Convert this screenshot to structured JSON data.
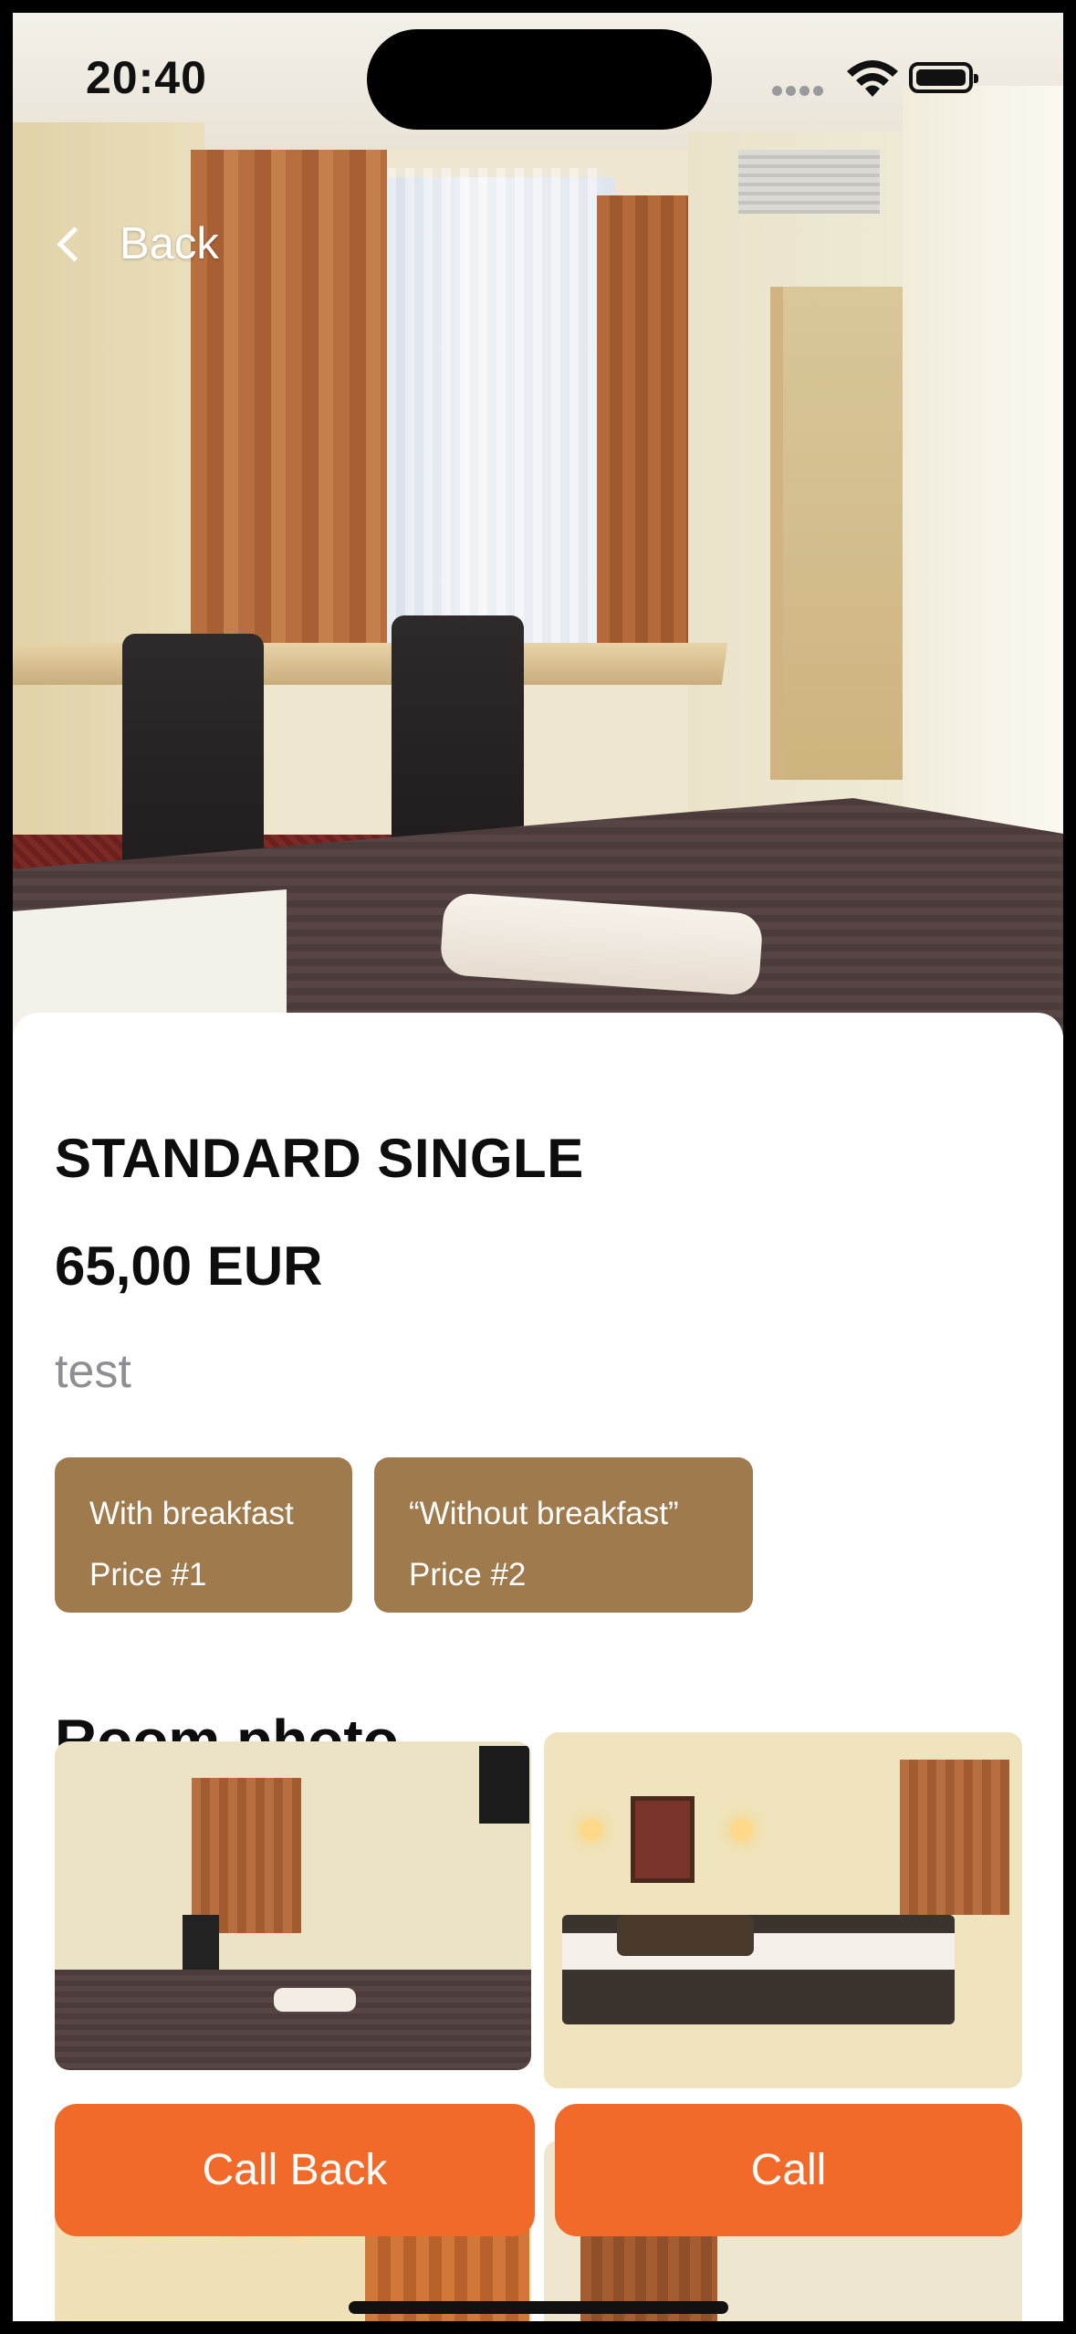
{
  "status_bar": {
    "time": "20:40"
  },
  "nav": {
    "back_label": "Back"
  },
  "room": {
    "title": "STANDARD SINGLE",
    "price": "65,00 EUR",
    "description": "test"
  },
  "options": [
    {
      "name": "With breakfast",
      "price_label": "Price #1"
    },
    {
      "name": "“Without breakfast”",
      "price_label": "Price #2"
    }
  ],
  "photos": {
    "section_title": "Room photo"
  },
  "actions": {
    "call_back_label": "Call Back",
    "call_label": "Call"
  },
  "colors": {
    "accent": "#f26a2a",
    "option_bg": "#9e7a4c",
    "muted_text": "#8e8e93"
  },
  "icons": [
    "chevron-left-icon",
    "wifi-icon",
    "battery-icon",
    "cellular-signal-icon"
  ]
}
